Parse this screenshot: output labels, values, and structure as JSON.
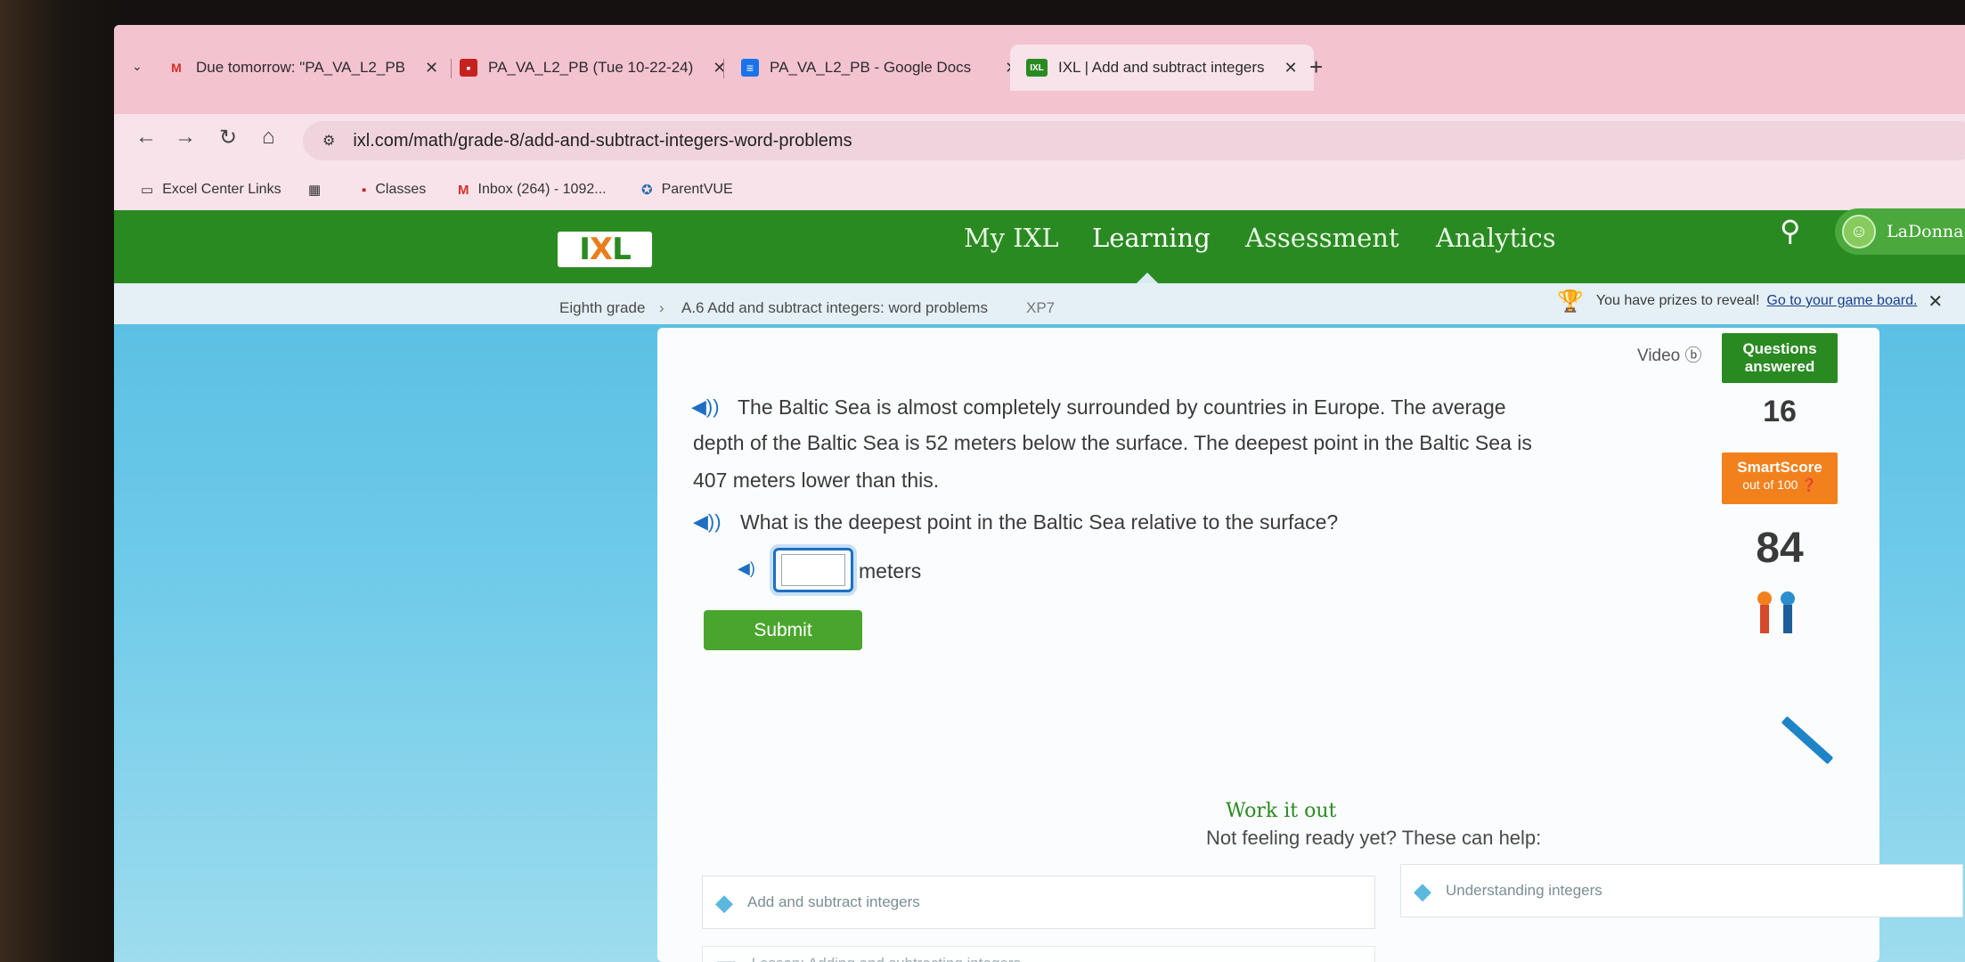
{
  "browser": {
    "tabs": [
      {
        "label": "Due tomorrow: \"PA_VA_L2_PB",
        "icon": "gmail-icon"
      },
      {
        "label": "PA_VA_L2_PB (Tue 10-22-24)",
        "icon": "classroom-icon"
      },
      {
        "label": "PA_VA_L2_PB - Google Docs",
        "icon": "docs-icon"
      },
      {
        "label": "IXL | Add and subtract integers",
        "icon": "ixl-favicon"
      }
    ],
    "url": "ixl.com/math/grade-8/add-and-subtract-integers-word-problems",
    "bookmarks": [
      "Excel Center Links",
      "Classes",
      "Inbox (264) - 1092...",
      "ParentVUE"
    ]
  },
  "ixl": {
    "logo": "IXL",
    "nav": [
      "My IXL",
      "Learning",
      "Assessment",
      "Analytics"
    ],
    "user": "LaDonna",
    "breadcrumb": {
      "grade": "Eighth grade",
      "skill": "A.6 Add and subtract integers: word problems",
      "code": "XP7"
    },
    "prize_text": "You have prizes to reveal!",
    "prize_link": "Go to your game board."
  },
  "question": {
    "line1": "The Baltic Sea is almost completely surrounded by countries in Europe. The average",
    "line2": "depth of the Baltic Sea is 52 meters below the surface. The deepest point in the Baltic Sea is",
    "line3": "407 meters lower than this.",
    "prompt": "What is the deepest point in the Baltic Sea relative to the surface?",
    "answer_value": "",
    "unit": "meters",
    "submit": "Submit"
  },
  "sidebar": {
    "video": "Video",
    "questions_answered_label": "Questions answered",
    "questions_answered": "16",
    "smartscore_label": "SmartScore",
    "smartscore_sub": "out of 100",
    "smartscore": "84"
  },
  "help": {
    "work_it_out": "Work it out",
    "not_ready": "Not feeling ready yet? These can help:",
    "skills": [
      "Add and subtract integers",
      "Understanding integers"
    ],
    "lesson": "Lesson: Adding and subtracting integers"
  },
  "colors": {
    "ixl_green": "#2a8a22",
    "smartscore_orange": "#f2811d",
    "tab_pink": "#f4c3d0"
  }
}
